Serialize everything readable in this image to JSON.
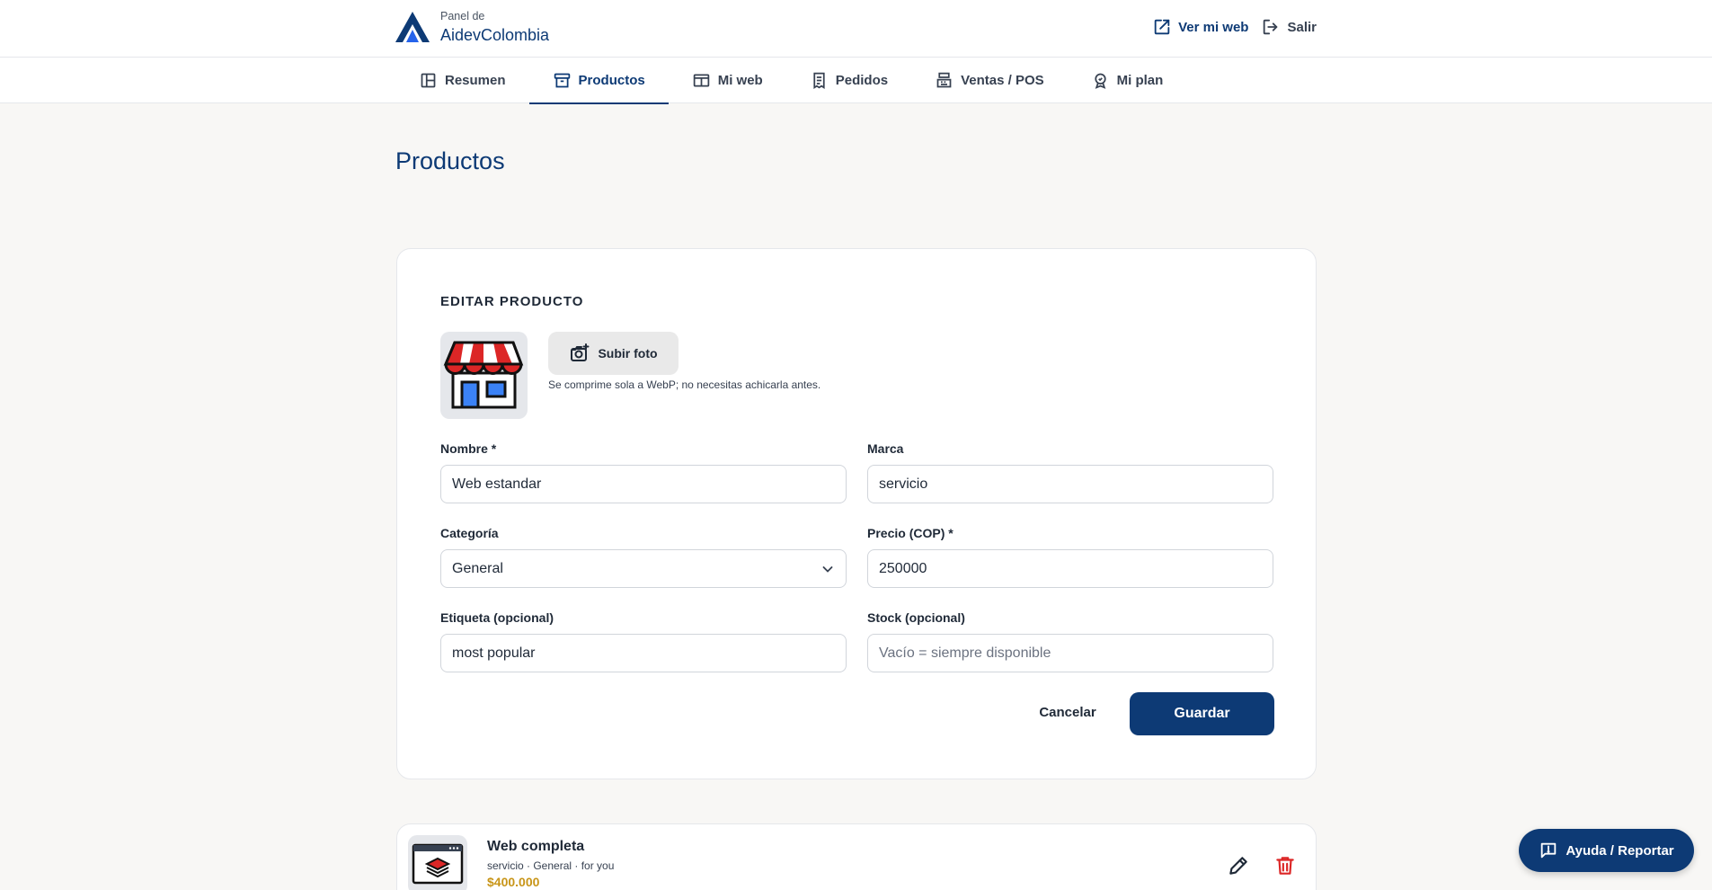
{
  "brand": {
    "subtitle": "Panel de",
    "name": "AidevColombia"
  },
  "top_actions": {
    "view_web": "Ver mi web",
    "logout": "Salir"
  },
  "nav": {
    "items": [
      {
        "label": "Resumen",
        "icon": "layout-icon"
      },
      {
        "label": "Productos",
        "icon": "archive-box-icon",
        "active": true
      },
      {
        "label": "Mi web",
        "icon": "browser-window-icon"
      },
      {
        "label": "Pedidos",
        "icon": "receipt-icon"
      },
      {
        "label": "Ventas / POS",
        "icon": "cash-register-icon"
      },
      {
        "label": "Mi plan",
        "icon": "badge-icon"
      }
    ]
  },
  "page": {
    "title": "Productos"
  },
  "editor": {
    "section_title": "EDITAR PRODUCTO",
    "upload_label": "Subir foto",
    "upload_hint": "Se comprime sola a WebP; no necesitas achicarla antes.",
    "fields": {
      "name": {
        "label": "Nombre *",
        "value": "Web estandar"
      },
      "brand": {
        "label": "Marca",
        "value": "servicio"
      },
      "category": {
        "label": "Categoría",
        "value": "General"
      },
      "price": {
        "label": "Precio (COP) *",
        "value": "250000"
      },
      "tag": {
        "label": "Etiqueta (opcional)",
        "value": "most popular"
      },
      "stock": {
        "label": "Stock (opcional)",
        "value": "",
        "placeholder": "Vacío = siempre disponible"
      }
    },
    "cancel_label": "Cancelar",
    "save_label": "Guardar"
  },
  "products": [
    {
      "name": "Web completa",
      "meta": "servicio · General · for you",
      "price": "$400.000"
    }
  ],
  "help": {
    "label": "Ayuda / Reportar"
  },
  "colors": {
    "primary": "#0d3a75",
    "price": "#c89518",
    "delete": "#dc2626"
  }
}
